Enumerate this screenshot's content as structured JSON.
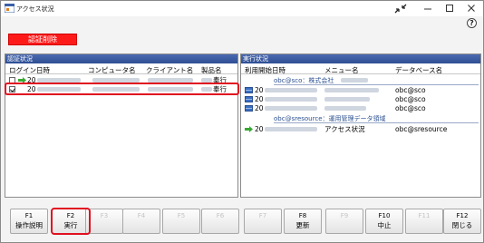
{
  "window": {
    "title": "アクセス状況"
  },
  "toolbar": {
    "cert_delete_label": "認証削除",
    "help_icon": "?"
  },
  "auth_panel": {
    "header": "認証状況",
    "columns": [
      "ログイン日時",
      "コンピュータ名",
      "クライアント名",
      "製品名"
    ],
    "rows": [
      {
        "checked": false,
        "login_prefix": "20",
        "product": "奉行"
      },
      {
        "checked": true,
        "login_prefix": "20",
        "product": "奉行"
      }
    ]
  },
  "exec_panel": {
    "header": "実行状況",
    "columns": [
      "利用開始日時",
      "メニュー名",
      "データベース名"
    ],
    "groups": [
      {
        "title": "obc@sco：株式会社",
        "rows": [
          {
            "start_prefix": "20",
            "db": "obc@sco"
          },
          {
            "start_prefix": "20",
            "db": "obc@sco"
          },
          {
            "start_prefix": "20",
            "db": "obc@sco"
          }
        ]
      },
      {
        "title": "obc@sresource：運用管理データ領域",
        "rows": [
          {
            "start_prefix": "20",
            "menu": "アクセス状況",
            "db": "obc@sresource"
          }
        ]
      }
    ]
  },
  "function_keys": [
    {
      "num": "F1",
      "label": "操作説明",
      "enabled": true
    },
    {
      "num": "F2",
      "label": "実行",
      "enabled": true
    },
    {
      "num": "F3",
      "label": "",
      "enabled": false
    },
    {
      "num": "F4",
      "label": "",
      "enabled": false
    },
    {
      "num": "F5",
      "label": "",
      "enabled": false
    },
    {
      "num": "F6",
      "label": "",
      "enabled": false
    },
    {
      "num": "F7",
      "label": "",
      "enabled": false
    },
    {
      "num": "F8",
      "label": "更新",
      "enabled": true
    },
    {
      "num": "F9",
      "label": "",
      "enabled": false
    },
    {
      "num": "F10",
      "label": "中止",
      "enabled": true
    },
    {
      "num": "F11",
      "label": "",
      "enabled": false
    },
    {
      "num": "F12",
      "label": "閉じる",
      "enabled": true
    }
  ]
}
